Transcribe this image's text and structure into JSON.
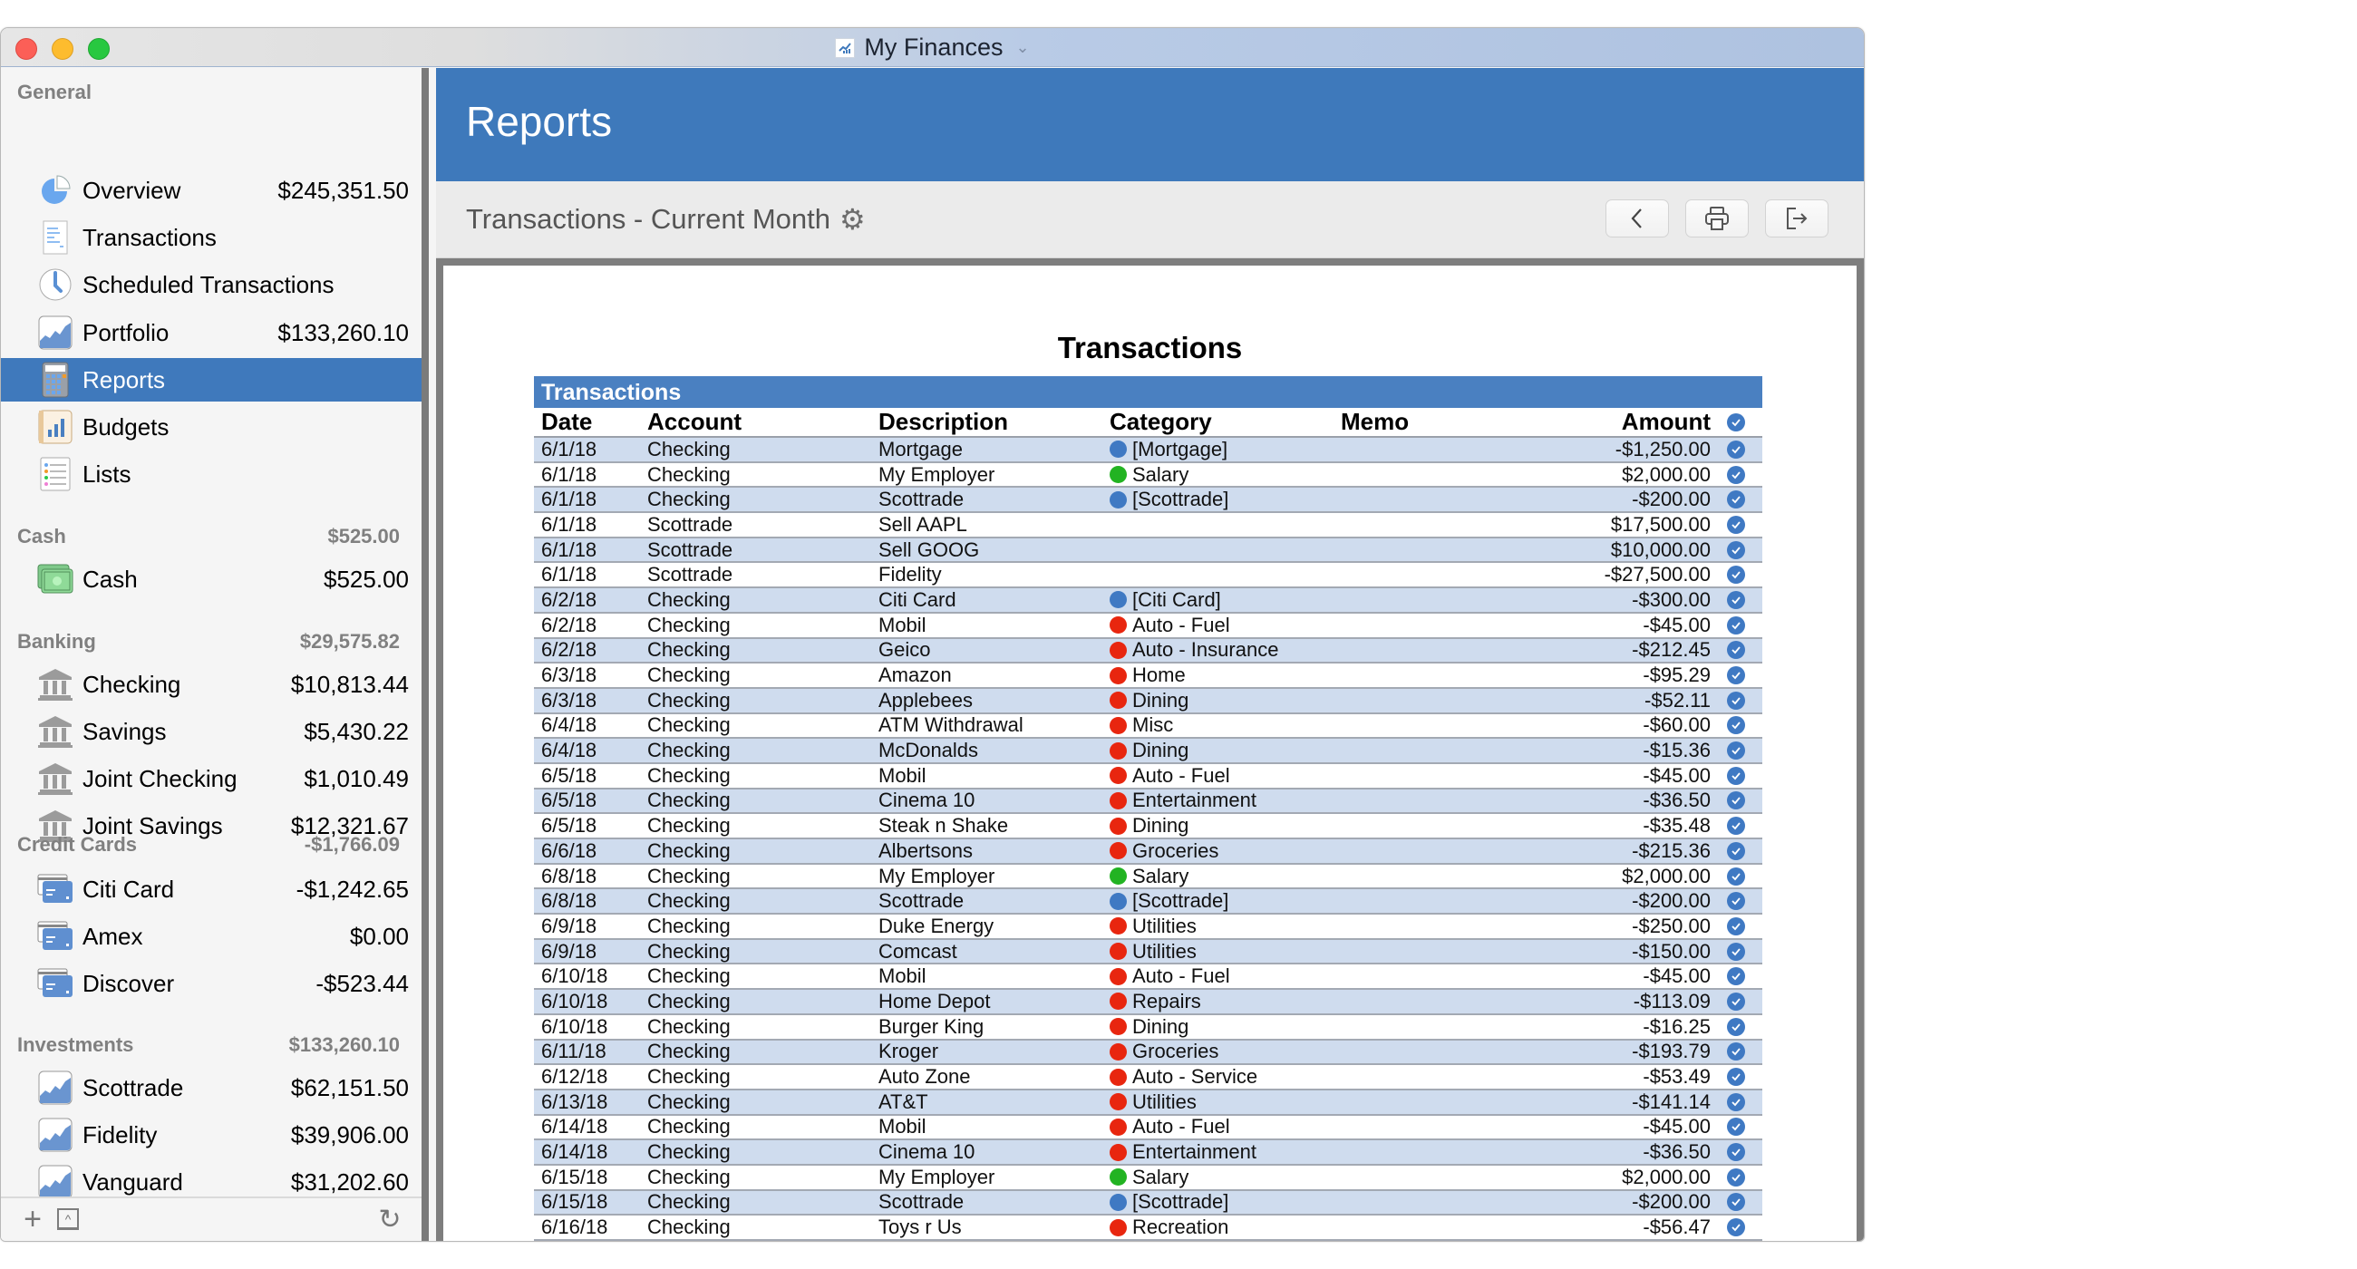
{
  "window": {
    "title": "My Finances",
    "title_chevron": "⌄"
  },
  "colors": {
    "accent": "#3e79bb",
    "category_transfer": "#3f79c3",
    "category_income": "#22b322",
    "category_expense": "#e8260f"
  },
  "sidebar": {
    "sections": [
      {
        "label": "General",
        "total": "",
        "items": [
          {
            "label": "Overview",
            "value": "$245,351.50",
            "icon": "pie-chart-icon"
          },
          {
            "label": "Transactions",
            "value": "",
            "icon": "receipt-icon"
          },
          {
            "label": "Scheduled Transactions",
            "value": "",
            "icon": "clock-icon"
          },
          {
            "label": "Portfolio",
            "value": "$133,260.10",
            "icon": "stock-chart-icon"
          },
          {
            "label": "Reports",
            "value": "",
            "icon": "calculator-icon",
            "selected": true
          },
          {
            "label": "Budgets",
            "value": "",
            "icon": "budget-book-icon"
          },
          {
            "label": "Lists",
            "value": "",
            "icon": "list-icon"
          }
        ]
      },
      {
        "label": "Cash",
        "total": "$525.00",
        "items": [
          {
            "label": "Cash",
            "value": "$525.00",
            "icon": "cash-icon"
          }
        ]
      },
      {
        "label": "Banking",
        "total": "$29,575.82",
        "items": [
          {
            "label": "Checking",
            "value": "$10,813.44",
            "icon": "bank-icon"
          },
          {
            "label": "Savings",
            "value": "$5,430.22",
            "icon": "bank-icon"
          },
          {
            "label": "Joint Checking",
            "value": "$1,010.49",
            "icon": "bank-icon"
          },
          {
            "label": "Joint Savings",
            "value": "$12,321.67",
            "icon": "bank-icon"
          }
        ]
      },
      {
        "label": "Credit Cards",
        "total": "-$1,766.09",
        "items": [
          {
            "label": "Citi Card",
            "value": "-$1,242.65",
            "icon": "credit-card-icon"
          },
          {
            "label": "Amex",
            "value": "$0.00",
            "icon": "credit-card-icon"
          },
          {
            "label": "Discover",
            "value": "-$523.44",
            "icon": "credit-card-icon"
          }
        ]
      },
      {
        "label": "Investments",
        "total": "$133,260.10",
        "items": [
          {
            "label": "Scottrade",
            "value": "$62,151.50",
            "icon": "stock-chart-icon"
          },
          {
            "label": "Fidelity",
            "value": "$39,906.00",
            "icon": "stock-chart-icon"
          },
          {
            "label": "Vanguard",
            "value": "$31,202.60",
            "icon": "stock-chart-icon"
          }
        ]
      }
    ],
    "bottom": {
      "add": "+",
      "collapse": "^",
      "refresh": "↻"
    }
  },
  "main": {
    "banner_title": "Reports",
    "report_name": "Transactions - Current Month",
    "toolbar": {
      "back": "back",
      "print": "print",
      "export": "export"
    },
    "report": {
      "title": "Transactions",
      "table_banner": "Transactions",
      "columns": [
        "Date",
        "Account",
        "Description",
        "Category",
        "Memo",
        "Amount"
      ],
      "rows": [
        {
          "date": "6/1/18",
          "account": "Checking",
          "description": "Mortgage",
          "category": "[Mortgage]",
          "cat_type": "transfer",
          "memo": "",
          "amount": "-$1,250.00",
          "cleared": true
        },
        {
          "date": "6/1/18",
          "account": "Checking",
          "description": "My Employer",
          "category": "Salary",
          "cat_type": "income",
          "memo": "",
          "amount": "$2,000.00",
          "cleared": true
        },
        {
          "date": "6/1/18",
          "account": "Checking",
          "description": "Scottrade",
          "category": "[Scottrade]",
          "cat_type": "transfer",
          "memo": "",
          "amount": "-$200.00",
          "cleared": true
        },
        {
          "date": "6/1/18",
          "account": "Scottrade",
          "description": "Sell AAPL",
          "category": "",
          "cat_type": "",
          "memo": "",
          "amount": "$17,500.00",
          "cleared": true
        },
        {
          "date": "6/1/18",
          "account": "Scottrade",
          "description": "Sell GOOG",
          "category": "",
          "cat_type": "",
          "memo": "",
          "amount": "$10,000.00",
          "cleared": true
        },
        {
          "date": "6/1/18",
          "account": "Scottrade",
          "description": "Fidelity",
          "category": "",
          "cat_type": "",
          "memo": "",
          "amount": "-$27,500.00",
          "cleared": true
        },
        {
          "date": "6/2/18",
          "account": "Checking",
          "description": "Citi Card",
          "category": "[Citi Card]",
          "cat_type": "transfer",
          "memo": "",
          "amount": "-$300.00",
          "cleared": true
        },
        {
          "date": "6/2/18",
          "account": "Checking",
          "description": "Mobil",
          "category": "Auto - Fuel",
          "cat_type": "expense",
          "memo": "",
          "amount": "-$45.00",
          "cleared": true
        },
        {
          "date": "6/2/18",
          "account": "Checking",
          "description": "Geico",
          "category": "Auto - Insurance",
          "cat_type": "expense",
          "memo": "",
          "amount": "-$212.45",
          "cleared": true
        },
        {
          "date": "6/3/18",
          "account": "Checking",
          "description": "Amazon",
          "category": "Home",
          "cat_type": "expense",
          "memo": "",
          "amount": "-$95.29",
          "cleared": true
        },
        {
          "date": "6/3/18",
          "account": "Checking",
          "description": "Applebees",
          "category": "Dining",
          "cat_type": "expense",
          "memo": "",
          "amount": "-$52.11",
          "cleared": true
        },
        {
          "date": "6/4/18",
          "account": "Checking",
          "description": "ATM Withdrawal",
          "category": "Misc",
          "cat_type": "expense",
          "memo": "",
          "amount": "-$60.00",
          "cleared": true
        },
        {
          "date": "6/4/18",
          "account": "Checking",
          "description": "McDonalds",
          "category": "Dining",
          "cat_type": "expense",
          "memo": "",
          "amount": "-$15.36",
          "cleared": true
        },
        {
          "date": "6/5/18",
          "account": "Checking",
          "description": "Mobil",
          "category": "Auto - Fuel",
          "cat_type": "expense",
          "memo": "",
          "amount": "-$45.00",
          "cleared": true
        },
        {
          "date": "6/5/18",
          "account": "Checking",
          "description": "Cinema 10",
          "category": "Entertainment",
          "cat_type": "expense",
          "memo": "",
          "amount": "-$36.50",
          "cleared": true
        },
        {
          "date": "6/5/18",
          "account": "Checking",
          "description": "Steak n Shake",
          "category": "Dining",
          "cat_type": "expense",
          "memo": "",
          "amount": "-$35.48",
          "cleared": true
        },
        {
          "date": "6/6/18",
          "account": "Checking",
          "description": "Albertsons",
          "category": "Groceries",
          "cat_type": "expense",
          "memo": "",
          "amount": "-$215.36",
          "cleared": true
        },
        {
          "date": "6/8/18",
          "account": "Checking",
          "description": "My Employer",
          "category": "Salary",
          "cat_type": "income",
          "memo": "",
          "amount": "$2,000.00",
          "cleared": true
        },
        {
          "date": "6/8/18",
          "account": "Checking",
          "description": "Scottrade",
          "category": "[Scottrade]",
          "cat_type": "transfer",
          "memo": "",
          "amount": "-$200.00",
          "cleared": true
        },
        {
          "date": "6/9/18",
          "account": "Checking",
          "description": "Duke Energy",
          "category": "Utilities",
          "cat_type": "expense",
          "memo": "",
          "amount": "-$250.00",
          "cleared": true
        },
        {
          "date": "6/9/18",
          "account": "Checking",
          "description": "Comcast",
          "category": "Utilities",
          "cat_type": "expense",
          "memo": "",
          "amount": "-$150.00",
          "cleared": true
        },
        {
          "date": "6/10/18",
          "account": "Checking",
          "description": "Mobil",
          "category": "Auto - Fuel",
          "cat_type": "expense",
          "memo": "",
          "amount": "-$45.00",
          "cleared": true
        },
        {
          "date": "6/10/18",
          "account": "Checking",
          "description": "Home Depot",
          "category": "Repairs",
          "cat_type": "expense",
          "memo": "",
          "amount": "-$113.09",
          "cleared": true
        },
        {
          "date": "6/10/18",
          "account": "Checking",
          "description": "Burger King",
          "category": "Dining",
          "cat_type": "expense",
          "memo": "",
          "amount": "-$16.25",
          "cleared": true
        },
        {
          "date": "6/11/18",
          "account": "Checking",
          "description": "Kroger",
          "category": "Groceries",
          "cat_type": "expense",
          "memo": "",
          "amount": "-$193.79",
          "cleared": true
        },
        {
          "date": "6/12/18",
          "account": "Checking",
          "description": "Auto Zone",
          "category": "Auto - Service",
          "cat_type": "expense",
          "memo": "",
          "amount": "-$53.49",
          "cleared": true
        },
        {
          "date": "6/13/18",
          "account": "Checking",
          "description": "AT&T",
          "category": "Utilities",
          "cat_type": "expense",
          "memo": "",
          "amount": "-$141.14",
          "cleared": true
        },
        {
          "date": "6/14/18",
          "account": "Checking",
          "description": "Mobil",
          "category": "Auto - Fuel",
          "cat_type": "expense",
          "memo": "",
          "amount": "-$45.00",
          "cleared": true
        },
        {
          "date": "6/14/18",
          "account": "Checking",
          "description": "Cinema 10",
          "category": "Entertainment",
          "cat_type": "expense",
          "memo": "",
          "amount": "-$36.50",
          "cleared": true
        },
        {
          "date": "6/15/18",
          "account": "Checking",
          "description": "My Employer",
          "category": "Salary",
          "cat_type": "income",
          "memo": "",
          "amount": "$2,000.00",
          "cleared": true
        },
        {
          "date": "6/15/18",
          "account": "Checking",
          "description": "Scottrade",
          "category": "[Scottrade]",
          "cat_type": "transfer",
          "memo": "",
          "amount": "-$200.00",
          "cleared": true
        },
        {
          "date": "6/16/18",
          "account": "Checking",
          "description": "Toys r Us",
          "category": "Recreation",
          "cat_type": "expense",
          "memo": "",
          "amount": "-$56.47",
          "cleared": true
        }
      ]
    }
  }
}
